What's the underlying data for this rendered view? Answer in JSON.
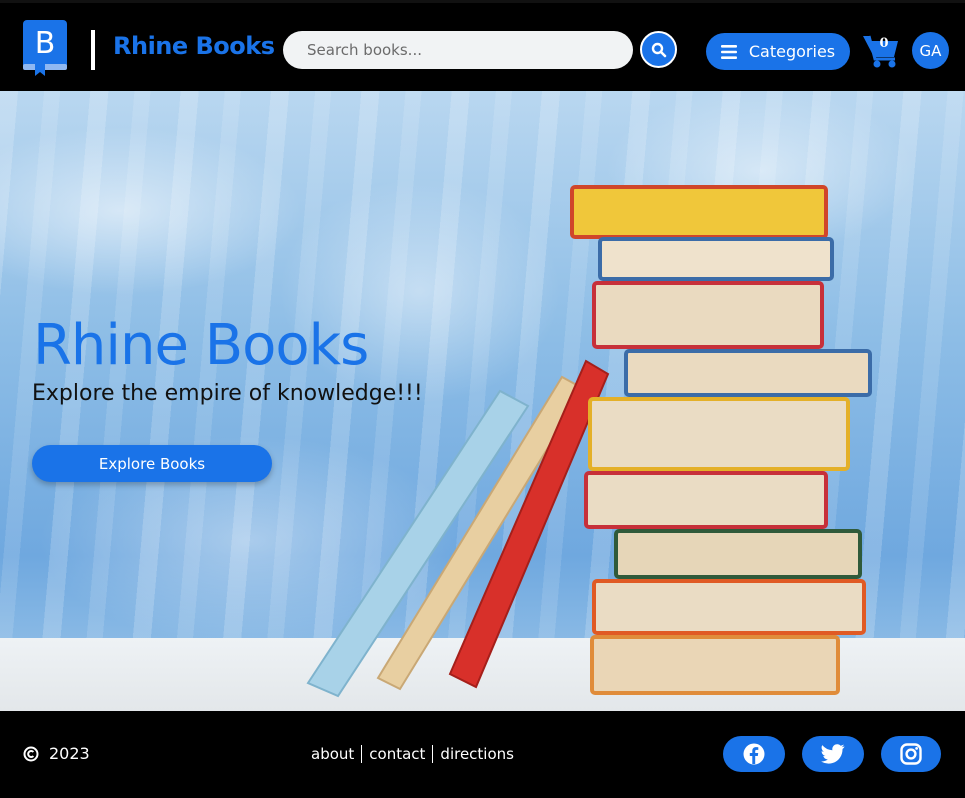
{
  "header": {
    "logo_letter": "B",
    "brand_name": "Rhine Books",
    "search_placeholder": "Search books...",
    "categories_label": "Categories",
    "cart_count": "0",
    "avatar_initials": "GA"
  },
  "hero": {
    "title": "Rhine Books",
    "subtitle": "Explore the empire of knowledge!!!",
    "cta_label": "Explore Books"
  },
  "footer": {
    "copyright_year": "2023",
    "links": [
      "about",
      "contact",
      "directions"
    ],
    "social": [
      "facebook-icon",
      "twitter-icon",
      "instagram-icon"
    ]
  },
  "colors": {
    "accent": "#1a73e8",
    "background": "#000000",
    "text_light": "#ffffff"
  }
}
